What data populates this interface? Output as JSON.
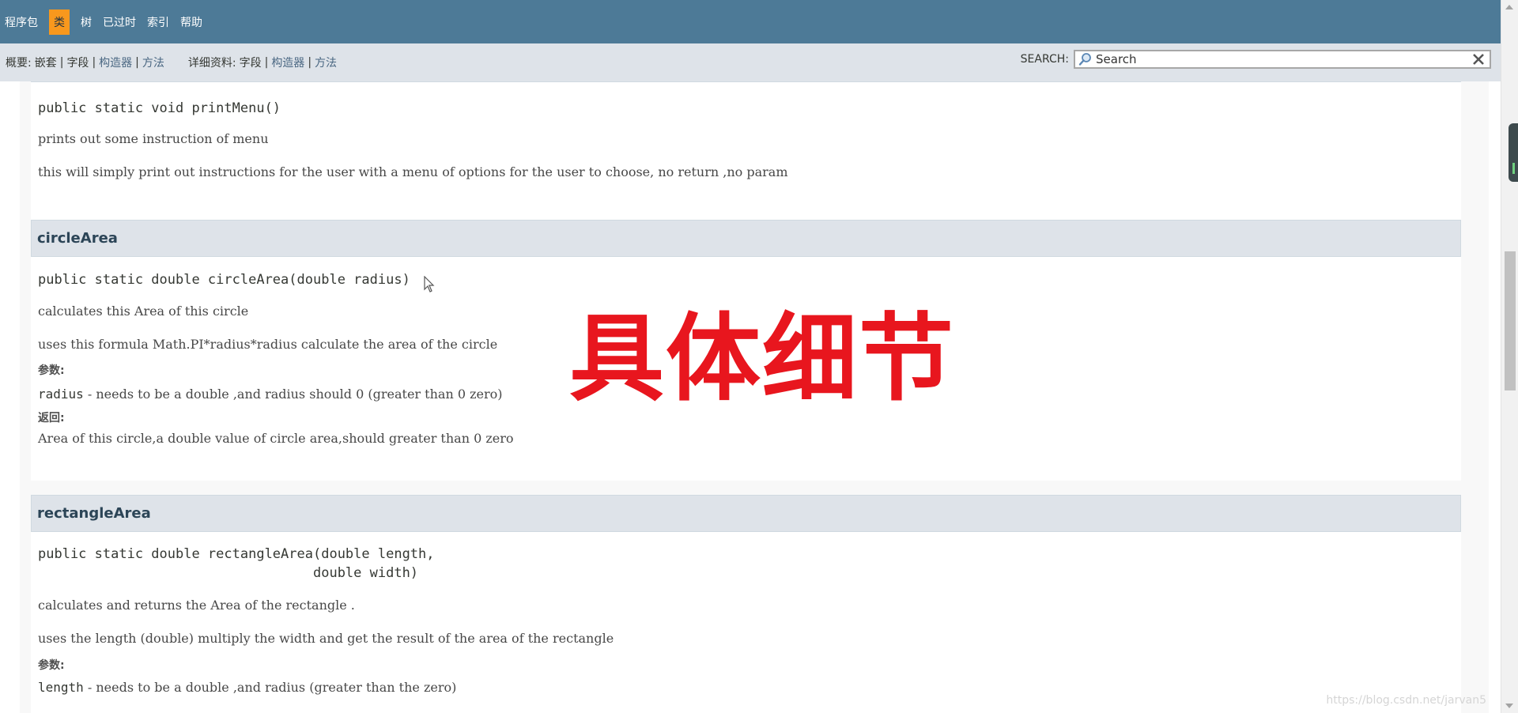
{
  "top_nav": {
    "items": [
      {
        "label": "程序包",
        "active": false
      },
      {
        "label": "类",
        "active": true
      },
      {
        "label": "树",
        "active": false
      },
      {
        "label": "已过时",
        "active": false
      },
      {
        "label": "索引",
        "active": false
      },
      {
        "label": "帮助",
        "active": false
      }
    ]
  },
  "sub_nav": {
    "summary_label": "概要:",
    "summary_nested": "嵌套",
    "summary_field": "字段",
    "summary_constructor": "构造器",
    "summary_method": "方法",
    "detail_label": "详细资料:",
    "detail_field": "字段",
    "detail_constructor": "构造器",
    "detail_method": "方法",
    "separator": "|"
  },
  "search": {
    "label": "SEARCH:",
    "placeholder": "Search",
    "icon": "search-icon",
    "reset_icon": "close-icon"
  },
  "methods": [
    {
      "signature": "public static void printMenu()",
      "description": "prints out some instruction of menu",
      "detail": "this will simply print out instructions for the user with a menu of options for the user to choose, no return ,no param"
    },
    {
      "name": "circleArea",
      "signature": "public static double circleArea(double radius)",
      "description": "calculates this Area of this circle",
      "detail": "uses this formula Math.PI*radius*radius calculate the area of the circle",
      "params_label": "参数:",
      "param_name": "radius",
      "param_desc": " - needs to be a double ,and radius should 0 (greater than 0 zero)",
      "returns_label": "返回:",
      "returns_desc": "Area of this circle,a double value of circle area,should greater than 0 zero"
    },
    {
      "name": "rectangleArea",
      "signature_line1": "public static double rectangleArea(double length,",
      "signature_line2": "                                  double width)",
      "description": "calculates and returns the Area of the rectangle .",
      "detail": "uses the length (double) multiply the width and get the result of the area of the rectangle",
      "params_label": "参数:",
      "param_name": "length",
      "param_desc": " - needs to be a double ,and radius (greater than the zero)"
    }
  ],
  "overlay_text": "具体细节",
  "watermark_url": "https://blog.csdn.net/jarvan5",
  "colors": {
    "nav_bg": "#4d7a97",
    "active_tab": "#f8981d",
    "subnav_bg": "#dee3e9",
    "overlay_red": "#e8161e",
    "link": "#4a6782"
  }
}
